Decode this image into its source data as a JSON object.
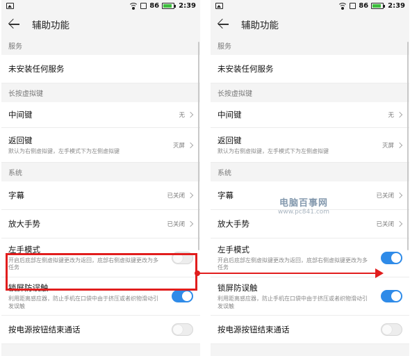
{
  "status": {
    "battery_level": "86",
    "time": "2:39",
    "battery_fill": 0.86,
    "battery_color": "#3dbd3d"
  },
  "header": {
    "title": "辅助功能"
  },
  "sections": {
    "services": "服务",
    "long_press": "长按虚拟键",
    "system": "系统"
  },
  "items": {
    "no_service": "未安装任何服务",
    "middle_key": {
      "label": "中间键",
      "value": "无"
    },
    "back_key": {
      "label": "返回键",
      "desc": "默认为右侧虚拟键，左手模式下为左侧虚拟键",
      "value": "灭屏"
    },
    "subtitles": {
      "label": "字幕",
      "value": "已关闭"
    },
    "magnify": {
      "label": "放大手势",
      "value": "已关闭"
    },
    "left_hand": {
      "label": "左手模式",
      "desc": "开启后底部左侧虚拟键更改为返回，底部右侧虚拟键更改为多任务"
    },
    "lock_touch": {
      "label": "锁屏防误触",
      "desc": "利用距离感应器，防止手机在口袋中由于挤压或者织物滑动引发误触"
    },
    "power_end_call": {
      "label": "按电源按钮结束通话"
    }
  },
  "toggles": {
    "left": {
      "left_hand": false,
      "lock_touch": true,
      "power_end_call": false
    },
    "right": {
      "left_hand": true,
      "lock_touch": true,
      "power_end_call": false
    }
  },
  "watermark": {
    "line1": "电脑百事网",
    "line2": "www.pc841.com"
  },
  "colors": {
    "accent": "#2f8be8",
    "highlight": "#e11d1d"
  }
}
